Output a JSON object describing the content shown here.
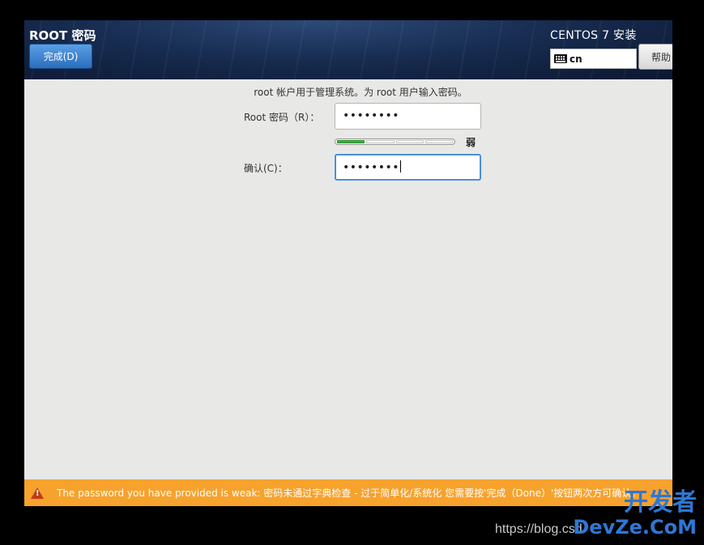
{
  "header": {
    "page_title": "ROOT 密码",
    "done_label": "完成(D)",
    "installer_title": "CENTOS 7 安装",
    "keyboard_layout": "cn",
    "help_label": "帮助"
  },
  "main": {
    "description": "root 帐户用于管理系统。为 root 用户输入密码。",
    "root_password_label": "Root 密码（R）：",
    "root_password_value": "••••••••",
    "strength_label": "弱",
    "strength_segments_filled": 1,
    "strength_segments_total": 4,
    "confirm_label": "确认(C)：",
    "confirm_value": "••••••••"
  },
  "warning": {
    "text": "The password you have provided is weak: 密码未通过字典检查 - 过于简单化/系统化 您需要按'完成（Done）'按钮两次方可确认。"
  },
  "overlay": {
    "watermark_top": "开发者",
    "watermark_bottom": "DevZe.CoM",
    "url": "https://blog.csd"
  },
  "colors": {
    "accent": "#2a6ebd",
    "warning_bar": "#f7a22d",
    "strength_fill": "#3cae3c"
  }
}
